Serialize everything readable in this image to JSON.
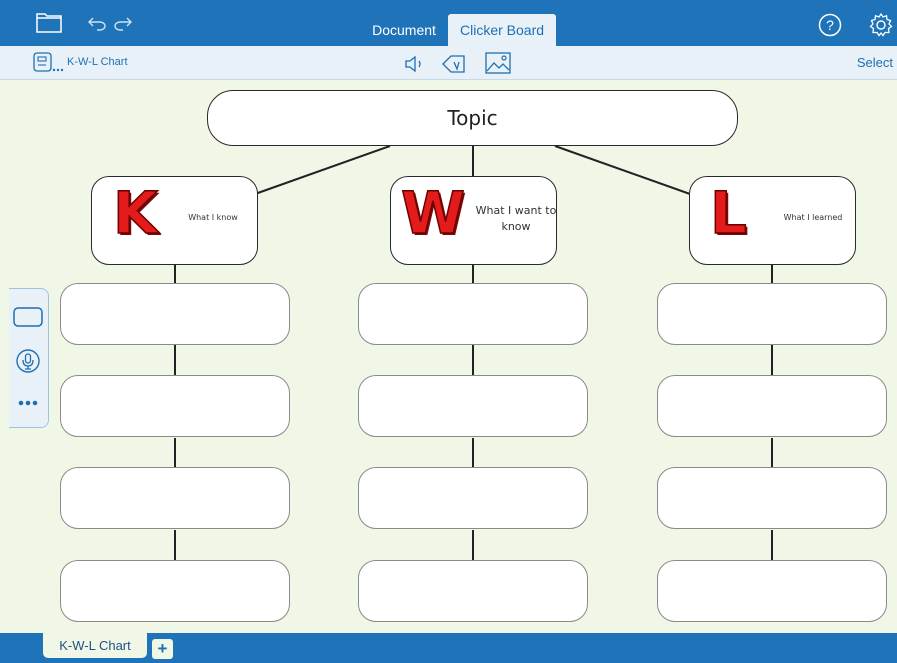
{
  "topbar": {
    "tabs": [
      {
        "label": "Document",
        "active": false
      },
      {
        "label": "Clicker Board",
        "active": true
      }
    ],
    "icons": [
      "folder-icon",
      "undo-icon",
      "redo-icon",
      "help-icon",
      "settings-icon"
    ]
  },
  "toolbar": {
    "doc_title": "K-W-L Chart",
    "select_label": "Select",
    "icons": [
      "board-icon",
      "speaker-icon",
      "cell-edit-icon",
      "picture-icon"
    ]
  },
  "board": {
    "topic": "Topic",
    "columns": [
      {
        "letter": "K",
        "label": "What I know",
        "cells": 4
      },
      {
        "letter": "W",
        "label": "What I want to know",
        "cells": 4
      },
      {
        "letter": "L",
        "label": "What I learned",
        "cells": 4
      }
    ]
  },
  "sidepanel": {
    "icons": [
      "cell-icon",
      "microphone-icon",
      "more-icon"
    ]
  },
  "bottombar": {
    "page_tab": "K-W-L Chart",
    "add_label": "+"
  },
  "colors": {
    "accent": "#1f74b9",
    "canvas": "#f1f7e6",
    "letter_red": "#e31b1b"
  }
}
